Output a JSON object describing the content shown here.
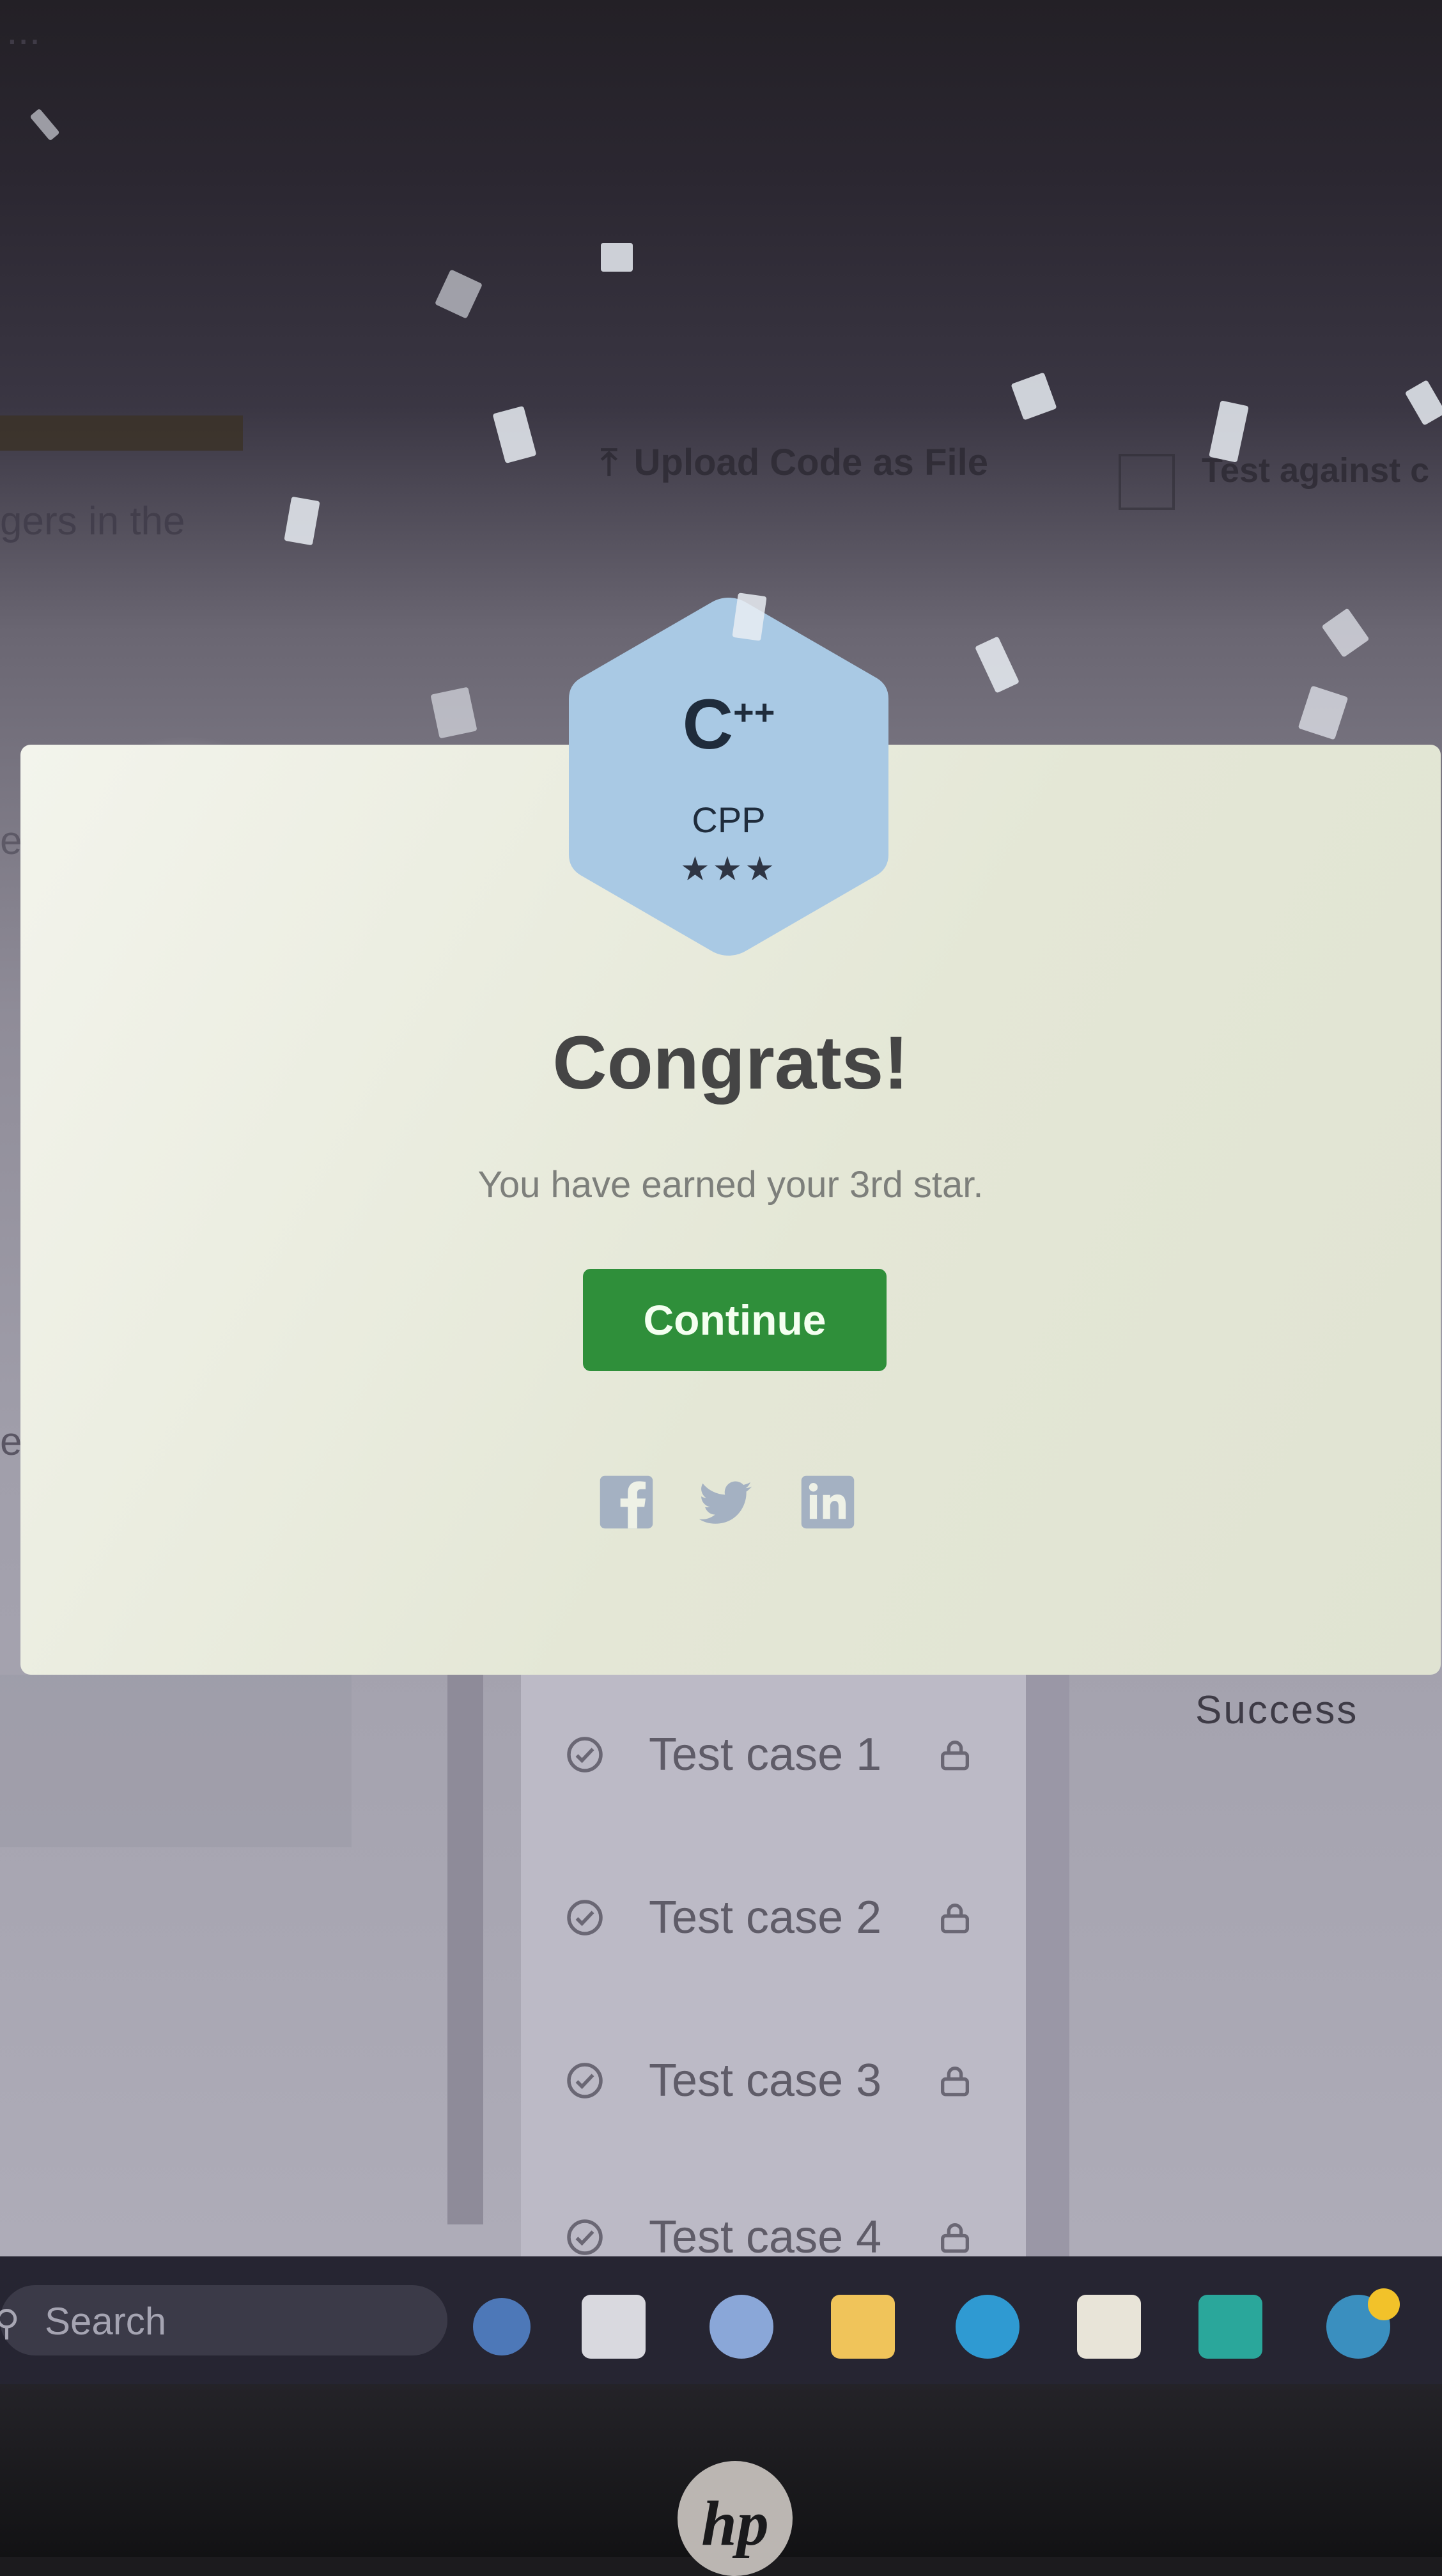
{
  "background": {
    "top_text": "...",
    "toolbar_upload_label": "Upload Code as File",
    "toolbar_test_label": "Test against c",
    "left_text": "gers in the",
    "left_fragment_1": "e",
    "left_fragment_2": "ed",
    "success_label": "Success",
    "test_cases": [
      {
        "label": "Test case 1",
        "icon": "lock-icon"
      },
      {
        "label": "Test case 2",
        "icon": "lock-icon"
      },
      {
        "label": "Test case 3",
        "icon": "lock-icon"
      },
      {
        "label": "Test case 4",
        "icon": "lock-icon"
      }
    ]
  },
  "modal": {
    "badge": {
      "title": "C",
      "title_suffix": "++",
      "subtitle": "CPP",
      "stars": "★★★",
      "color": "#a9c9e4"
    },
    "heading": "Congrats!",
    "message": "You have earned your 3rd star.",
    "continue_label": "Continue",
    "continue_color": "#2f8f3a",
    "social_icons": [
      "facebook-icon",
      "twitter-icon",
      "linkedin-icon"
    ]
  },
  "taskbar": {
    "search_placeholder": "Search",
    "icons": [
      "copilot-icon",
      "task-view-icon",
      "chat-icon",
      "file-explorer-icon",
      "edge-icon",
      "store-icon",
      "app-icon",
      "weather-icon"
    ],
    "app_icon_label": "..."
  },
  "device": {
    "logo": "hp"
  }
}
